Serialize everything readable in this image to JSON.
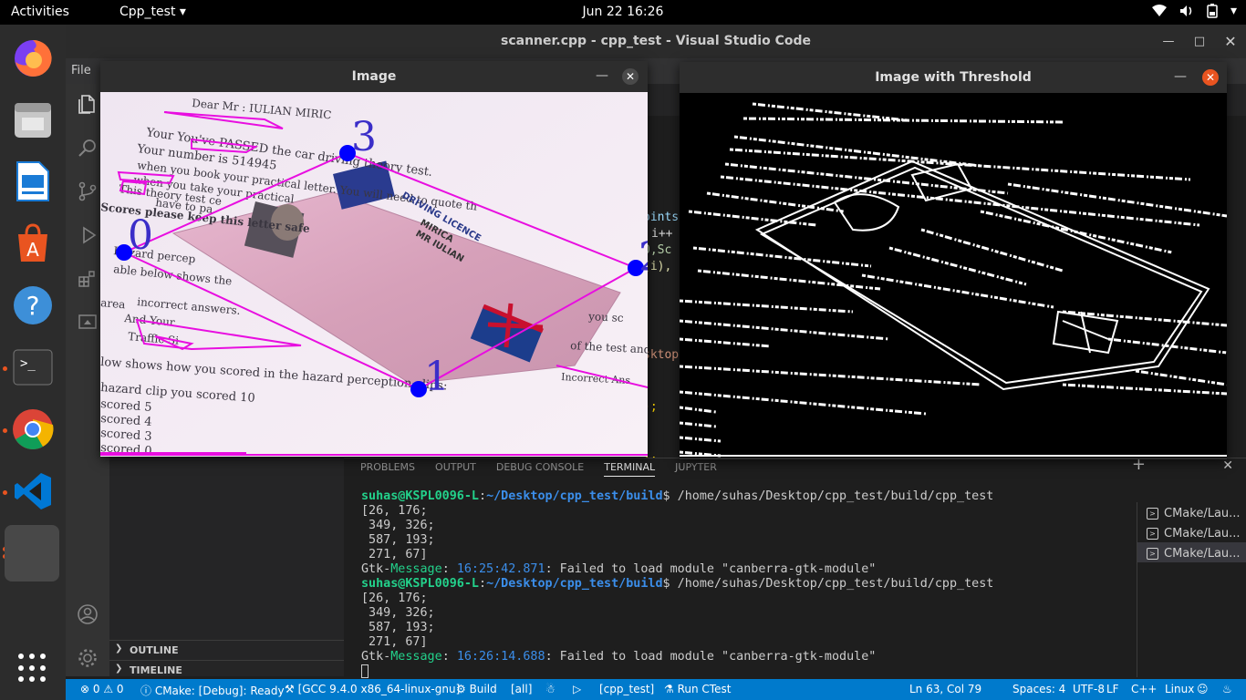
{
  "topbar": {
    "activities": "Activities",
    "app_menu": "Cpp_test",
    "clock": "Jun 22  16:26"
  },
  "dock": {
    "items": [
      "Firefox",
      "Files",
      "LibreOffice Writer",
      "Ubuntu Software",
      "Help",
      "Terminal",
      "Chrome",
      "Visual Studio Code",
      "Cpp_test"
    ],
    "icons": [
      "firefox-icon",
      "files-icon",
      "writer-icon",
      "software-icon",
      "help-icon",
      "terminal-icon",
      "chrome-icon",
      "vscode-icon",
      "app-icon"
    ]
  },
  "vscode": {
    "title": "scanner.cpp - cpp_test - Visual Studio Code",
    "menu_file": "File",
    "sidebar": {
      "outline": "OUTLINE",
      "timeline": "TIMELINE"
    },
    "tab_partial": "s",
    "code_fragments": [
      "oints",
      "i++",
      "0,Sc",
      "(i),",
      "sktop",
      ");",
      ");"
    ]
  },
  "panel": {
    "tabs": [
      "PROBLEMS",
      "OUTPUT",
      "DEBUG CONSOLE",
      "TERMINAL",
      "JUPYTER"
    ],
    "active_tab": "TERMINAL",
    "terminal": {
      "prompt_user": "suhas@KSPL0096-L",
      "prompt_path": "~/Desktop/cpp_test/build",
      "command": "$ /home/suhas/Desktop/cpp_test/build/cpp_test",
      "output_lines": [
        "[26, 176;",
        " 349, 326;",
        " 587, 193;",
        " 271, 67]"
      ],
      "gtk_label": "Gtk-",
      "gtk_message": "Message",
      "run1_time": "16:25:42.871",
      "run2_time": "16:26:14.688",
      "gtk_text": ": Failed to load module \"canberra-gtk-module\""
    },
    "terminal_list": [
      "CMake/Lau...",
      "CMake/Lau...",
      "CMake/Lau..."
    ]
  },
  "statusbar": {
    "problems": "⊗ 0 ⚠ 0",
    "cmake": "ⓘ CMake: [Debug]: Ready",
    "kit": "⚒ [GCC 9.4.0 x86_64-linux-gnu]",
    "build": "⚙ Build",
    "target_all": "[all]",
    "debug": "☃",
    "run": "▷",
    "launch_target": "[cpp_test]",
    "ctest": "⚗ Run CTest",
    "position": "Ln 63, Col 79",
    "spaces": "Spaces: 4",
    "encoding": "UTF-8",
    "eol": "LF",
    "language": "C++",
    "os": "Linux"
  },
  "image_window": {
    "title": "Image",
    "corner_labels": [
      "0",
      "1",
      "2",
      "3"
    ],
    "card_text": [
      "DRIVING LICENCE",
      "MIRICA",
      "MR IULIAN"
    ],
    "doc_lines": [
      "Dear Mr : IULIAN MIRIC",
      "Your You've PASSED the car driving theory test.",
      "Your number is 514945",
      "when you book your practical letter. You will need to quote th",
      "when you take your practical",
      "Scores please keep this letter safe",
      "This theory test ce",
      "have to pa",
      "Hazard percep",
      "able below shows the",
      "area",
      "And Your",
      "Traffic Si",
      "low shows how you scored in the hazard perception clips:",
      "hazard clip you scored 10",
      "scored 5",
      "scored 4",
      "scored 3",
      "scored 0",
      "incorrect answers.",
      "of the test and",
      "you sc",
      "Incorrect Ans"
    ]
  },
  "threshold_window": {
    "title": "Image with Threshold"
  },
  "colors": {
    "accent": "#007acc",
    "ubuntu_orange": "#e95420",
    "magenta": "#e80ee0",
    "blue_point": "#0000ff"
  }
}
